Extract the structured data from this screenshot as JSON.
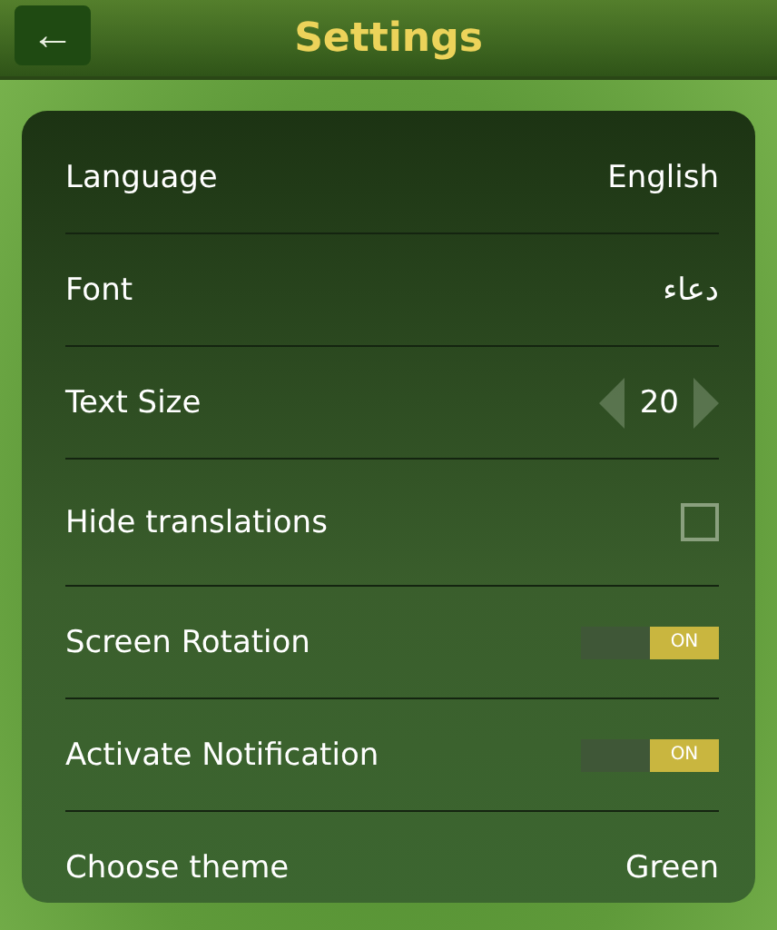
{
  "header": {
    "back_icon": "←",
    "title": "Settings"
  },
  "settings": [
    {
      "kind": "value",
      "label": "Language",
      "value": "English"
    },
    {
      "kind": "value",
      "label": "Font",
      "value": "دعاء"
    },
    {
      "kind": "stepper",
      "label": "Text Size",
      "value": "20"
    },
    {
      "kind": "checkbox",
      "label": "Hide translations",
      "checked": false
    },
    {
      "kind": "toggle",
      "label": "Screen Rotation",
      "on": true,
      "toggle_label": "ON"
    },
    {
      "kind": "toggle",
      "label": "Activate Notification",
      "on": true,
      "toggle_label": "ON"
    },
    {
      "kind": "value",
      "label": "Choose theme",
      "value": "Green"
    }
  ]
}
